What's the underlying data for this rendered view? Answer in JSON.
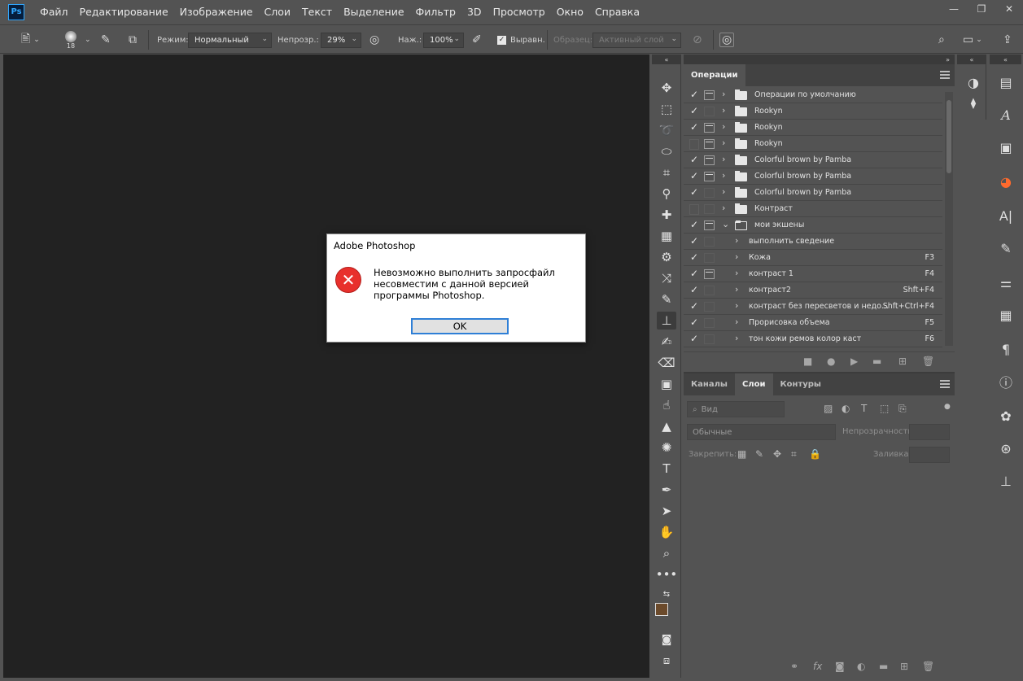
{
  "app": {
    "logo": "Ps"
  },
  "menu": [
    "Файл",
    "Редактирование",
    "Изображение",
    "Слои",
    "Текст",
    "Выделение",
    "Фильтр",
    "3D",
    "Просмотр",
    "Окно",
    "Справка"
  ],
  "window_controls": {
    "minimize": "—",
    "restore": "❐",
    "close": "✕"
  },
  "options_bar": {
    "brush_size": "18",
    "mode_label": "Режим:",
    "mode_value": "Нормальный",
    "opacity_label": "Непрозр.:",
    "opacity_value": "29%",
    "pressure_label": "Наж.:",
    "pressure_value": "100%",
    "aligned_label": "Выравн.",
    "sample_label": "Образец:",
    "sample_value": "Активный слой"
  },
  "dialog": {
    "title": "Adobe Photoshop",
    "message": "Невозможно выполнить запросфайл несовместим с данной версией программы Photoshop.",
    "ok_label": "OK",
    "icon": "error-icon"
  },
  "operations_panel": {
    "tab_label": "Операции",
    "rows": [
      {
        "label": "Операции по умолчанию",
        "checked": true,
        "dialog": true,
        "type": "folder",
        "key": ""
      },
      {
        "label": "Rookyn",
        "checked": true,
        "dialog": false,
        "type": "folder",
        "key": ""
      },
      {
        "label": "Rookyn",
        "checked": true,
        "dialog": true,
        "type": "folder",
        "key": ""
      },
      {
        "label": "Rookyn",
        "checked": false,
        "dialog": true,
        "type": "folder",
        "key": ""
      },
      {
        "label": "Colorful brown by Pamba",
        "checked": true,
        "dialog": true,
        "type": "folder",
        "key": ""
      },
      {
        "label": "Colorful brown by Pamba",
        "checked": true,
        "dialog": true,
        "type": "folder",
        "key": ""
      },
      {
        "label": "Colorful brown by Pamba",
        "checked": true,
        "dialog": false,
        "type": "folder",
        "key": ""
      },
      {
        "label": "Контраст",
        "checked": false,
        "dialog": false,
        "type": "folder",
        "key": ""
      },
      {
        "label": "мои экшены",
        "checked": true,
        "dialog": true,
        "type": "folder-open",
        "key": ""
      },
      {
        "label": "выполнить сведение",
        "checked": true,
        "dialog": false,
        "type": "action",
        "key": ""
      },
      {
        "label": "Кожа",
        "checked": true,
        "dialog": false,
        "type": "action",
        "key": "F3"
      },
      {
        "label": "контраст 1",
        "checked": true,
        "dialog": true,
        "type": "action",
        "key": "F4"
      },
      {
        "label": "контраст2",
        "checked": true,
        "dialog": false,
        "type": "action",
        "key": "Shft+F4"
      },
      {
        "label": "контраст без пересветов и недо...",
        "checked": true,
        "dialog": false,
        "type": "action",
        "key": "Shft+Ctrl+F4"
      },
      {
        "label": "Прорисовка объема",
        "checked": true,
        "dialog": false,
        "type": "action",
        "key": "F5"
      },
      {
        "label": "тон кожи ремов колор каст",
        "checked": true,
        "dialog": false,
        "type": "action",
        "key": "F6"
      }
    ]
  },
  "layers_panel": {
    "tabs": [
      "Каналы",
      "Слои",
      "Контуры"
    ],
    "active_tab": "Слои",
    "search_placeholder": "Вид",
    "blend_mode": "Обычные",
    "opacity_label": "Непрозрачность:",
    "lock_label": "Закрепить:",
    "fill_label": "Заливка:"
  },
  "colors": {
    "foreground": "#6b4a2b",
    "background": "#b9c8dc",
    "accent": "#31a8ff"
  }
}
